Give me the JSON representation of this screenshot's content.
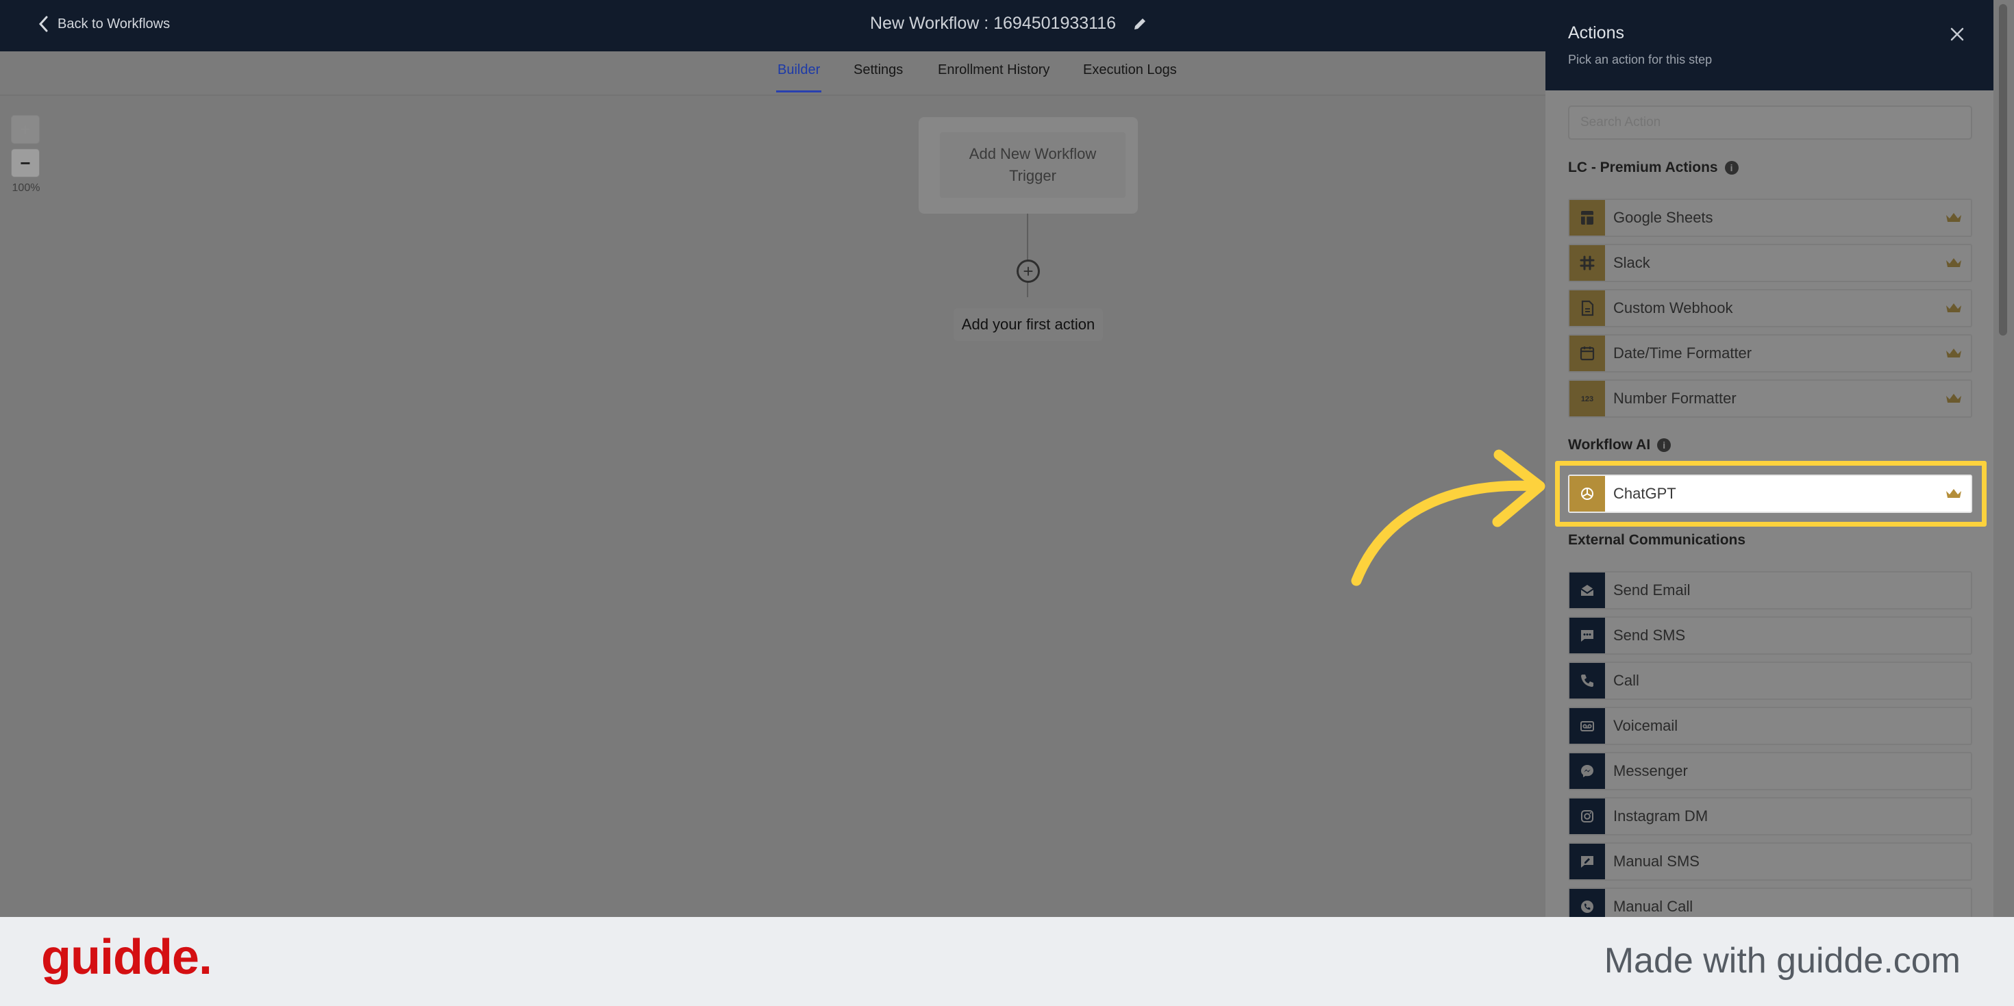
{
  "topbar": {
    "back_label": "Back to Workflows",
    "workflow_title": "New Workflow : 1694501933116"
  },
  "tabs": [
    {
      "label": "Builder",
      "active": true
    },
    {
      "label": "Settings",
      "active": false
    },
    {
      "label": "Enrollment History",
      "active": false
    },
    {
      "label": "Execution Logs",
      "active": false
    }
  ],
  "canvas": {
    "zoom_in": "+",
    "zoom_out": "−",
    "zoom_level": "100%",
    "trigger_label": "Add New Workflow Trigger",
    "add_symbol": "+",
    "first_action_label": "Add your first action"
  },
  "panel": {
    "title": "Actions",
    "subtitle": "Pick an action for this step",
    "search_placeholder": "Search Action",
    "sections": {
      "premium": "LC - Premium Actions",
      "ai": "Workflow AI",
      "external": "External Communications"
    },
    "info_glyph": "i",
    "premium_items": [
      {
        "label": "Google Sheets",
        "icon": "google-sheets-icon"
      },
      {
        "label": "Slack",
        "icon": "slack-icon"
      },
      {
        "label": "Custom Webhook",
        "icon": "webhook-icon"
      },
      {
        "label": "Date/Time Formatter",
        "icon": "calendar-icon"
      },
      {
        "label": "Number Formatter",
        "icon": "number-icon"
      }
    ],
    "ai_items": [
      {
        "label": "ChatGPT",
        "icon": "chatgpt-icon",
        "highlighted": true
      }
    ],
    "external_items": [
      {
        "label": "Send Email",
        "icon": "email-icon"
      },
      {
        "label": "Send SMS",
        "icon": "sms-icon"
      },
      {
        "label": "Call",
        "icon": "phone-icon"
      },
      {
        "label": "Voicemail",
        "icon": "voicemail-icon"
      },
      {
        "label": "Messenger",
        "icon": "messenger-icon"
      },
      {
        "label": "Instagram DM",
        "icon": "instagram-icon"
      },
      {
        "label": "Manual SMS",
        "icon": "manual-sms-icon"
      },
      {
        "label": "Manual Call",
        "icon": "manual-call-icon"
      }
    ],
    "number_glyph": "123"
  },
  "footer": {
    "brand": "guidde.",
    "made_with": "Made with guidde.com"
  },
  "colors": {
    "header_bg": "#111b2b",
    "highlight": "#fdd23d",
    "brand_red": "#d40f12",
    "active_tab": "#1d3aa8",
    "premium_gold": "#b48e39"
  }
}
